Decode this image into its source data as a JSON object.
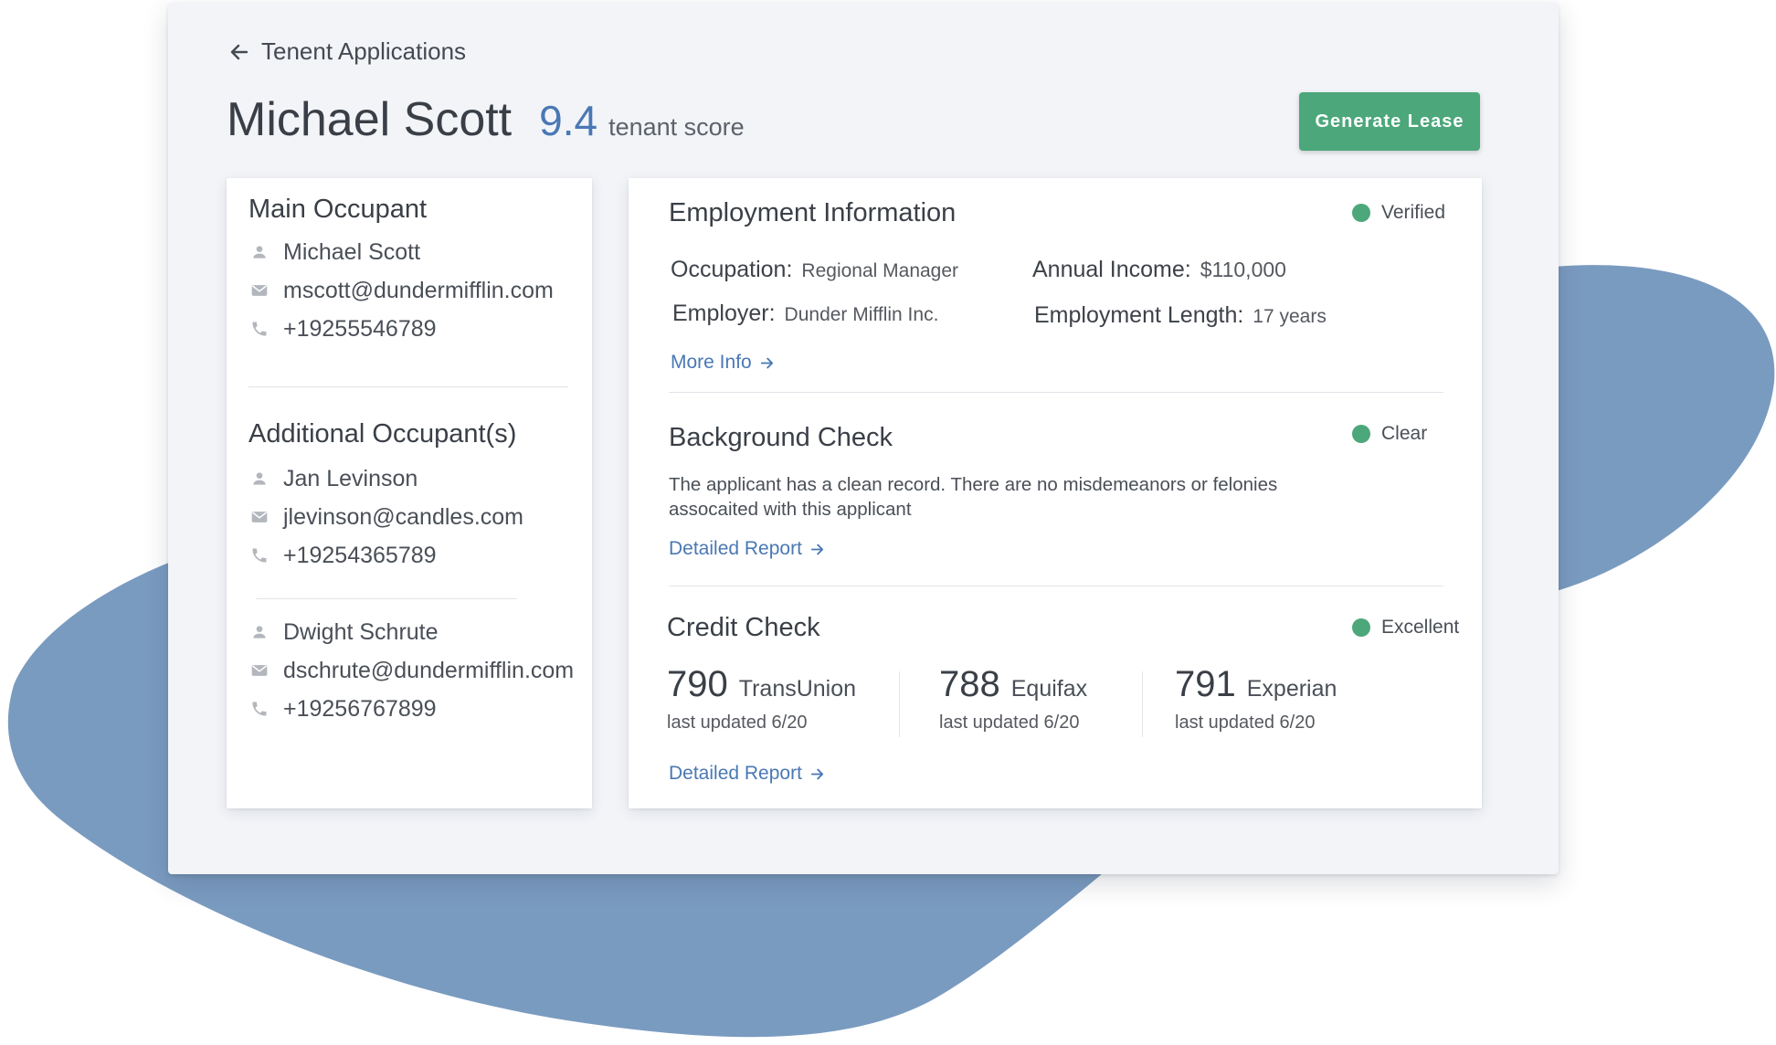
{
  "breadcrumb": {
    "label": "Tenent Applications"
  },
  "header": {
    "name": "Michael Scott",
    "score": "9.4",
    "score_label": "tenant score",
    "generate_button": "Generate Lease"
  },
  "main_occupant": {
    "title": "Main Occupant",
    "name": "Michael Scott",
    "email": "mscott@dundermifflin.com",
    "phone": "+19255546789"
  },
  "additional_occupants": {
    "title": "Additional Occupant(s)",
    "people": [
      {
        "name": "Jan Levinson",
        "email": "jlevinson@candles.com",
        "phone": "+19254365789"
      },
      {
        "name": "Dwight Schrute",
        "email": "dschrute@dundermifflin.com",
        "phone": "+19256767899"
      }
    ]
  },
  "employment": {
    "title": "Employment Information",
    "status": "Verified",
    "occupation_label": "Occupation:",
    "occupation": "Regional Manager",
    "employer_label": "Employer:",
    "employer": "Dunder Mifflin Inc.",
    "income_label": "Annual Income:",
    "income": "$110,000",
    "length_label": "Employment Length:",
    "length": "17 years",
    "link": "More Info"
  },
  "background": {
    "title": "Background Check",
    "status": "Clear",
    "text": "The applicant has a clean record. There are no misdemeanors or felonies assocaited with this applicant",
    "link": "Detailed Report"
  },
  "credit": {
    "title": "Credit Check",
    "status": "Excellent",
    "scores": [
      {
        "score": "790",
        "bureau": "TransUnion",
        "updated": "last updated 6/20"
      },
      {
        "score": "788",
        "bureau": "Equifax",
        "updated": "last updated 6/20"
      },
      {
        "score": "791",
        "bureau": "Experian",
        "updated": "last updated 6/20"
      }
    ],
    "link": "Detailed Report"
  },
  "colors": {
    "accent": "#4a78b4",
    "success": "#4ca77a",
    "blob": "#7a9bc0",
    "background": "#f2f4f8"
  },
  "icons": [
    "arrow-left-icon",
    "person-icon",
    "mail-icon",
    "phone-icon",
    "arrow-right-icon"
  ]
}
